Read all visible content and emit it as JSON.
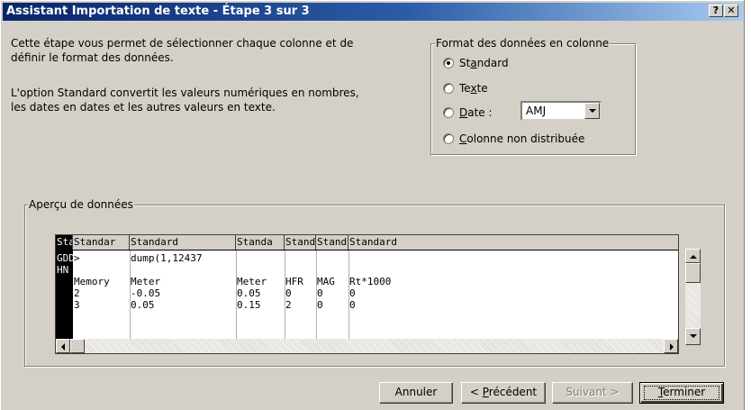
{
  "window": {
    "title": "Assistant Importation de texte - Étape 3 sur 3",
    "help_glyph": "?",
    "close_glyph": "✕"
  },
  "intro": {
    "line1": "Cette étape vous permet de sélectionner chaque colonne et de",
    "line2": "définir le format des données.",
    "line3": "L'option Standard convertit les valeurs numériques en nombres,",
    "line4": "les dates en dates et les autres valeurs en texte."
  },
  "format_group": {
    "label": "Format des données en colonne",
    "options": [
      {
        "pre": "St",
        "key": "a",
        "post": "ndard",
        "selected": true
      },
      {
        "pre": "Te",
        "key": "x",
        "post": "te",
        "selected": false
      },
      {
        "pre": "",
        "key": "D",
        "post": "ate :",
        "selected": false
      },
      {
        "pre": "",
        "key": "C",
        "post": "olonne non distribuée",
        "selected": false
      }
    ],
    "date_value": "AMJ"
  },
  "preview": {
    "label": "Aperçu de données",
    "headers": [
      "Stand",
      "Standar",
      "Standard",
      "Standa",
      "Stand",
      "Stand",
      "Standard"
    ],
    "rows": [
      [
        "GDD",
        ">",
        "dump(1,12437",
        "",
        "",
        "",
        ""
      ],
      [
        "HN",
        "",
        "",
        "",
        "",
        "",
        ""
      ],
      [
        "",
        "Memory",
        "Meter",
        "Meter",
        "HFR",
        "MAG",
        "Rt*1000"
      ],
      [
        "",
        "2",
        "-0.05",
        "0.05",
        "0",
        "0",
        "0"
      ],
      [
        "",
        "3",
        "0.05",
        "0.15",
        "2",
        "0",
        "0"
      ]
    ]
  },
  "buttons": {
    "cancel": "Annuler",
    "previous_pre": "< ",
    "previous_key": "P",
    "previous_post": "récédent",
    "next": "Suivant >",
    "finish_key": "T",
    "finish_post": "erminer"
  },
  "colors": {
    "face": "#d4d0c8",
    "title_start": "#0a246a",
    "title_end": "#a6caf0",
    "selected_column": "#000000"
  }
}
